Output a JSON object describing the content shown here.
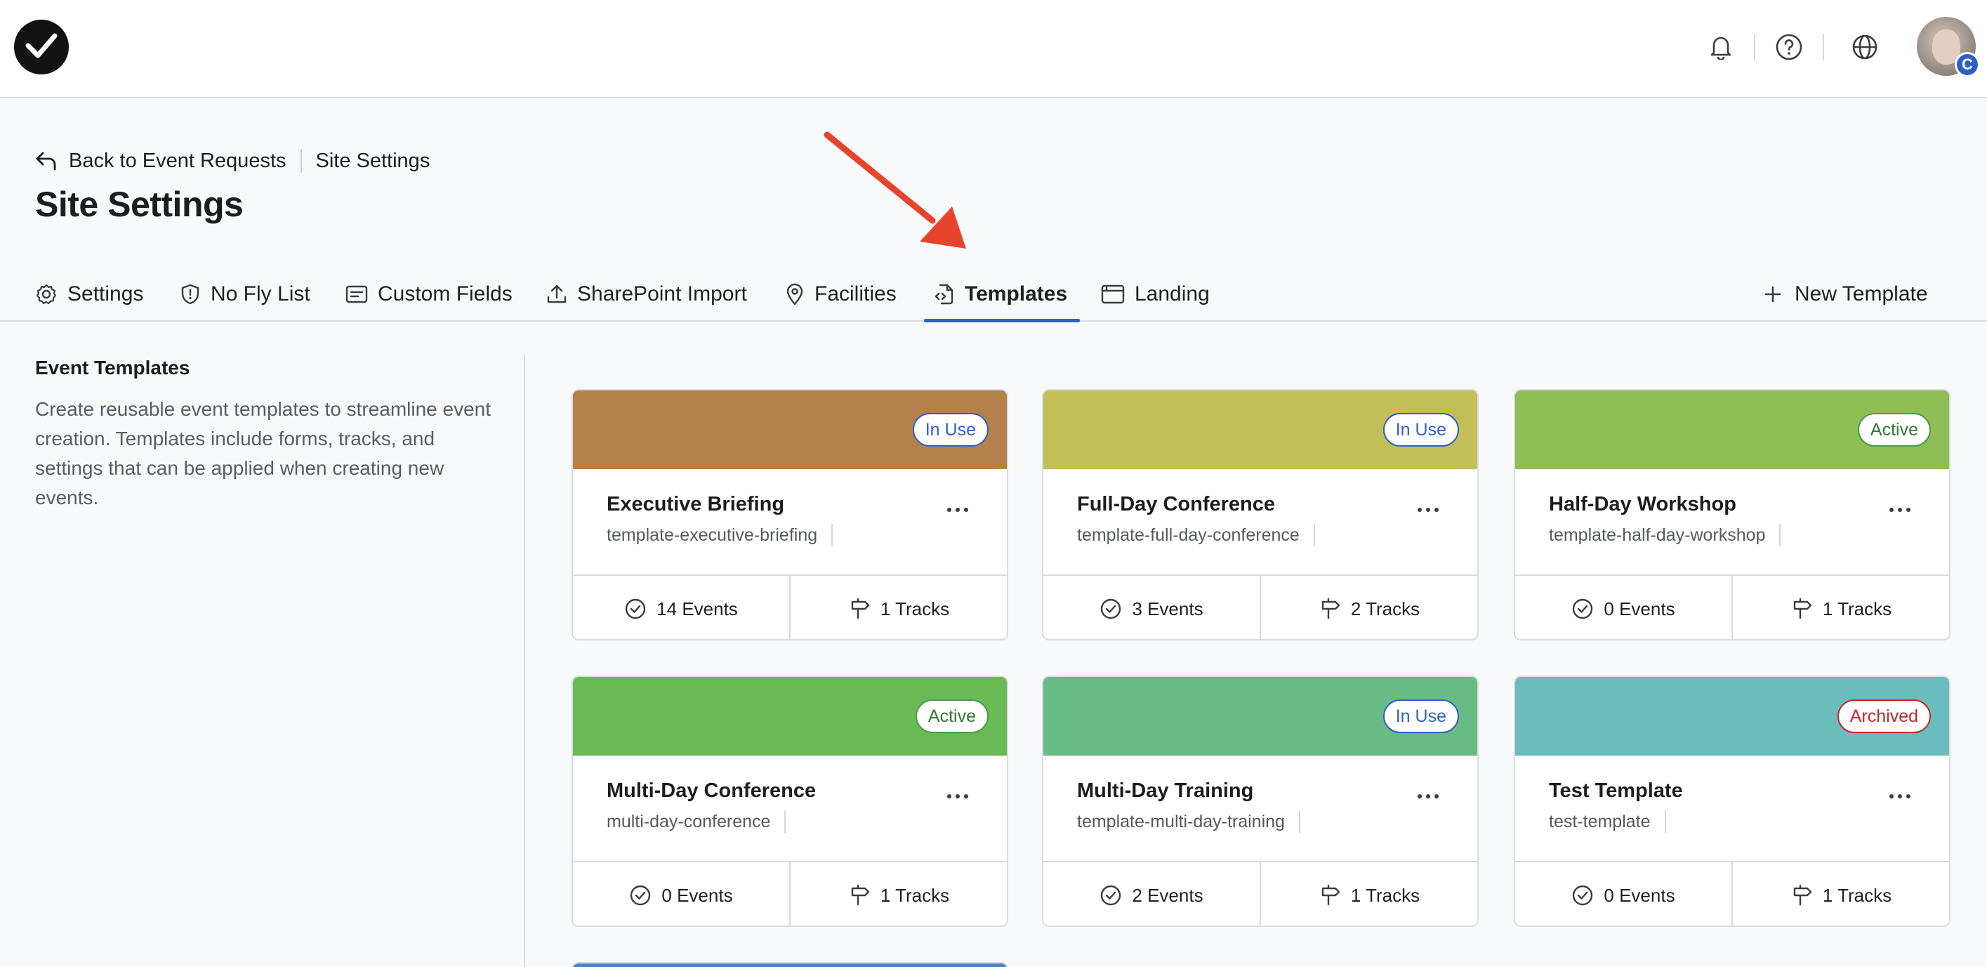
{
  "breadcrumb": {
    "back_label": "Back to Event Requests",
    "current": "Site Settings"
  },
  "page_title": "Site Settings",
  "tabs": [
    {
      "label": "Settings",
      "icon": "gear-icon"
    },
    {
      "label": "No Fly List",
      "icon": "shield-icon"
    },
    {
      "label": "Custom Fields",
      "icon": "form-icon"
    },
    {
      "label": "SharePoint Import",
      "icon": "upload-icon"
    },
    {
      "label": "Facilities",
      "icon": "location-pin-icon"
    },
    {
      "label": "Templates",
      "icon": "file-code-icon",
      "active": true
    },
    {
      "label": "Landing",
      "icon": "browser-window-icon"
    }
  ],
  "new_template_label": "New Template",
  "left_panel": {
    "heading": "Event Templates",
    "description": "Create reusable event templates to streamline event creation. Templates include forms, tracks, and settings that can be applied when creating new events."
  },
  "colors": {
    "accent": "#2f62c9",
    "in_use": "#2e5fc8",
    "active": "#2f7a2f",
    "archived": "#c0282a"
  },
  "cards": [
    {
      "title": "Executive Briefing",
      "slug": "template-executive-briefing",
      "status": "In Use",
      "color": "#b5814a",
      "events": "14 Events",
      "tracks": "1 Tracks"
    },
    {
      "title": "Full-Day Conference",
      "slug": "template-full-day-conference",
      "status": "In Use",
      "color": "#c1bf55",
      "events": "3 Events",
      "tracks": "2 Tracks"
    },
    {
      "title": "Half-Day Workshop",
      "slug": "template-half-day-workshop",
      "status": "Active",
      "color": "#8fbe55",
      "events": "0 Events",
      "tracks": "1 Tracks"
    },
    {
      "title": "Multi-Day Conference",
      "slug": "multi-day-conference",
      "status": "Active",
      "color": "#69b955",
      "events": "0 Events",
      "tracks": "1 Tracks"
    },
    {
      "title": "Multi-Day Training",
      "slug": "template-multi-day-training",
      "status": "In Use",
      "color": "#69bb86",
      "events": "2 Events",
      "tracks": "1 Tracks"
    },
    {
      "title": "Test Template",
      "slug": "test-template",
      "status": "Archived",
      "color": "#6bbdbd",
      "events": "0 Events",
      "tracks": "1 Tracks"
    }
  ]
}
